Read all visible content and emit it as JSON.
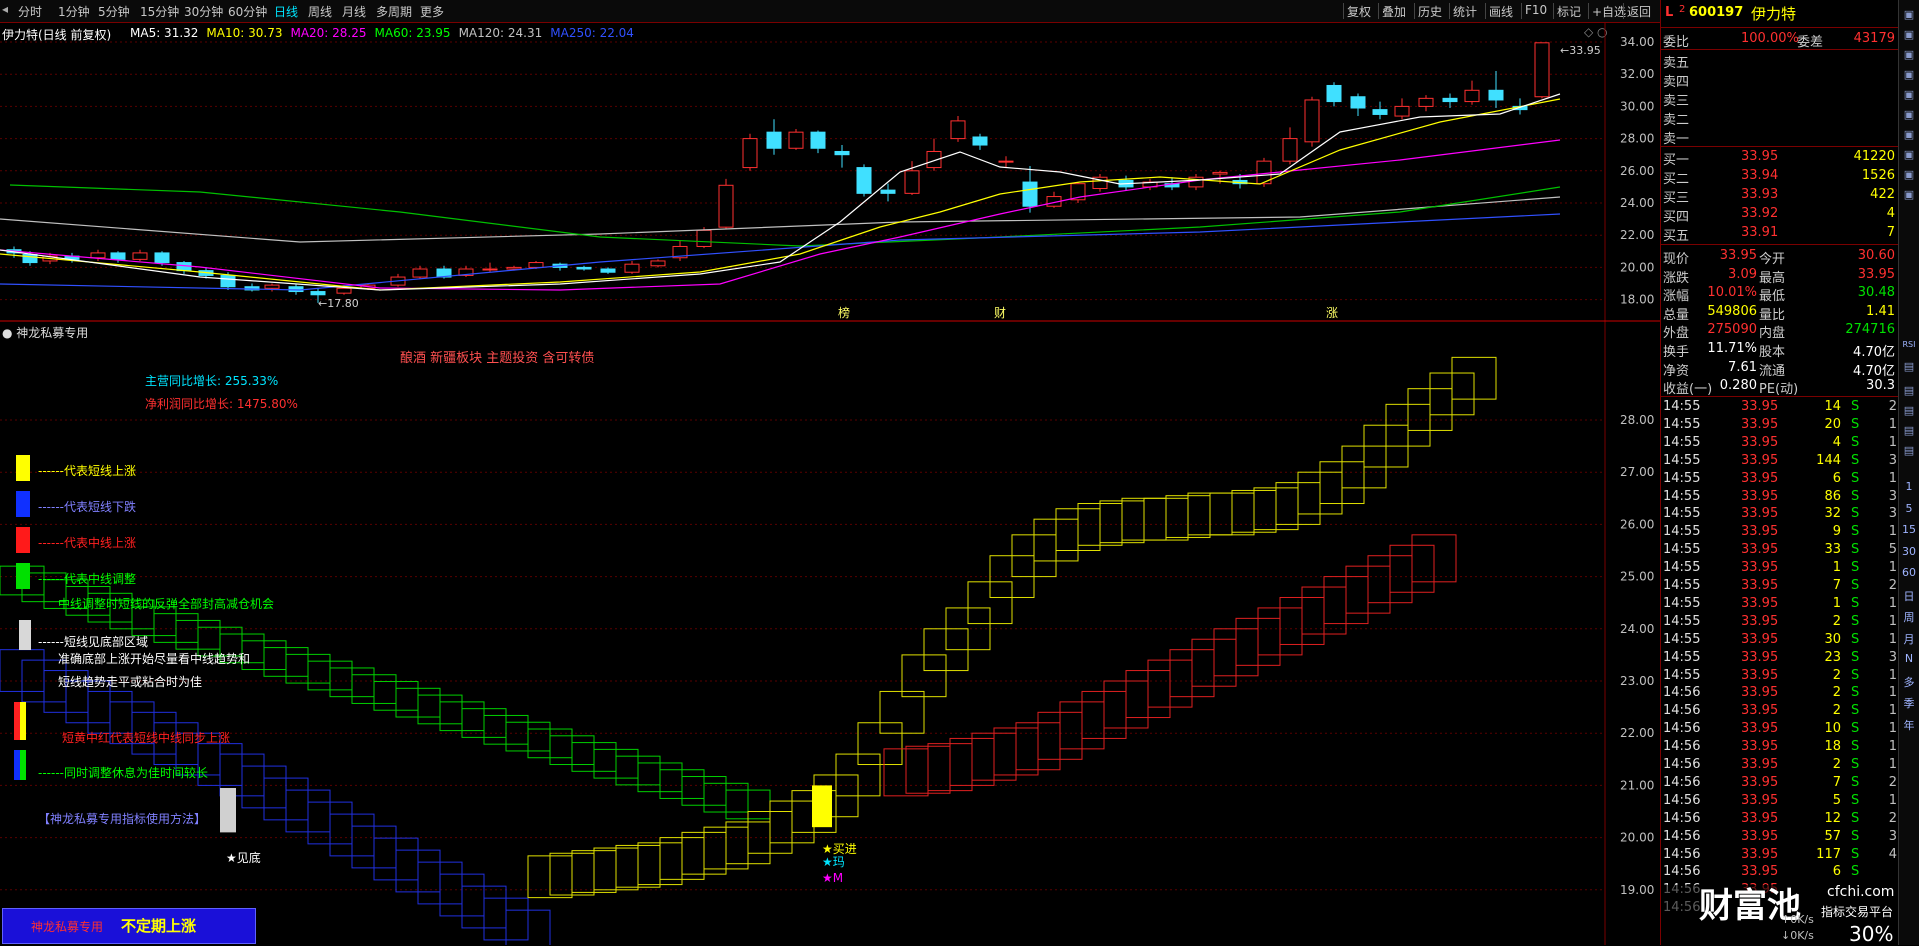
{
  "toolbar": {
    "periods": [
      "分时",
      "1分钟",
      "5分钟",
      "15分钟",
      "30分钟",
      "60分钟",
      "日线",
      "周线",
      "月线",
      "多周期",
      "更多"
    ],
    "active_period": "日线",
    "actions": [
      "复权",
      "叠加",
      "历史",
      "统计",
      "画线",
      "F10",
      "标记",
      "+自选",
      "返回"
    ]
  },
  "price_chart": {
    "title": "伊力特(日线 前复权)",
    "ma": [
      {
        "label": "MA5: 31.32",
        "color": "#ffffff"
      },
      {
        "label": "MA10: 30.73",
        "color": "#ffff00"
      },
      {
        "label": "MA20: 28.25",
        "color": "#ff00ff"
      },
      {
        "label": "MA60: 23.95",
        "color": "#00ff00"
      },
      {
        "label": "MA120: 24.31",
        "color": "#c0c0c0"
      },
      {
        "label": "MA250: 22.04",
        "color": "#3050ff"
      }
    ],
    "y_ticks": [
      "34.00",
      "32.00",
      "30.00",
      "28.00",
      "26.00",
      "24.00",
      "22.00",
      "20.00",
      "18.00"
    ],
    "high_label": "33.95",
    "low_label": "17.80",
    "markers": [
      "榜",
      "财",
      "涨"
    ]
  },
  "indicator": {
    "title": "神龙私募专用",
    "tags": "酿酒 新疆板块 主题投资 含可转债",
    "revenue_growth": "主营同比增长: 255.33%",
    "profit_growth": "净利润同比增长: 1475.80%",
    "y_ticks": [
      "28.00",
      "27.00",
      "26.00",
      "25.00",
      "24.00",
      "23.00",
      "22.00",
      "21.00",
      "20.00",
      "19.00"
    ],
    "legend": [
      {
        "text": "------代表短线上涨",
        "color": "#ffff00"
      },
      {
        "text": "------代表短线下跌",
        "color": "#8080ff"
      },
      {
        "text": "------代表中线上涨",
        "color": "#ff2020"
      },
      {
        "text": "------代表中线调整",
        "color": "#00ff00"
      },
      {
        "text": "中线调整时短线的反弹全部封高减仓机会",
        "color": "#00ff00"
      },
      {
        "text": "------短线见底部区域",
        "color": "#ffffff"
      },
      {
        "text": "准确底部上涨开始尽量看中线趋势和",
        "color": "#ffffff"
      },
      {
        "text": "短线趋势走平或粘合时为佳",
        "color": "#ffffff"
      },
      {
        "text": "短黄中红代表短线中线同步上涨",
        "color": "#ff2020"
      },
      {
        "text": "------同时调整休息为佳时间较长",
        "color": "#00ff00"
      }
    ],
    "usage_label": "【神龙私募专用指标使用方法】",
    "bottom_label": "神龙私募专用",
    "bottom_highlight": "不定期上涨",
    "signals": {
      "bottom": "★见底",
      "buy": "★买进",
      "j": "★玛",
      "m": "★M"
    }
  },
  "quote": {
    "code": "600197",
    "name": "伊力特",
    "weibi_label": "委比",
    "weibi": "100.00%",
    "weicha_label": "委差",
    "weicha": "43179",
    "sell": [
      "卖五",
      "卖四",
      "卖三",
      "卖二",
      "卖一"
    ],
    "buy": [
      {
        "label": "买一",
        "price": "33.95",
        "vol": "41220"
      },
      {
        "label": "买二",
        "price": "33.94",
        "vol": "1526"
      },
      {
        "label": "买三",
        "price": "33.93",
        "vol": "422"
      },
      {
        "label": "买四",
        "price": "33.92",
        "vol": "4"
      },
      {
        "label": "买五",
        "price": "33.91",
        "vol": "7"
      }
    ],
    "stats": [
      {
        "l1": "现价",
        "v1": "33.95",
        "c1": "#ff3030",
        "l2": "今开",
        "v2": "30.60",
        "c2": "#ff3030"
      },
      {
        "l1": "涨跌",
        "v1": "3.09",
        "c1": "#ff3030",
        "l2": "最高",
        "v2": "33.95",
        "c2": "#ff3030"
      },
      {
        "l1": "涨幅",
        "v1": "10.01%",
        "c1": "#ff3030",
        "l2": "最低",
        "v2": "30.48",
        "c2": "#00e000"
      },
      {
        "l1": "总量",
        "v1": "549806",
        "c1": "#ffff00",
        "l2": "量比",
        "v2": "1.41",
        "c2": "#ffff00"
      },
      {
        "l1": "外盘",
        "v1": "275090",
        "c1": "#ff3030",
        "l2": "内盘",
        "v2": "274716",
        "c2": "#00e000"
      },
      {
        "l1": "换手",
        "v1": "11.71%",
        "c1": "#ffffff",
        "l2": "股本",
        "v2": "4.70亿",
        "c2": "#ffffff"
      },
      {
        "l1": "净资",
        "v1": "7.61",
        "c1": "#ffffff",
        "l2": "流通",
        "v2": "4.70亿",
        "c2": "#ffffff"
      },
      {
        "l1": "收益(一)",
        "v1": "0.280",
        "c1": "#ffffff",
        "l2": "PE(动)",
        "v2": "30.3",
        "c2": "#ffffff"
      }
    ],
    "ticks": [
      {
        "t": "14:55",
        "p": "33.95",
        "v": "14",
        "n": "2"
      },
      {
        "t": "14:55",
        "p": "33.95",
        "v": "20",
        "n": "1"
      },
      {
        "t": "14:55",
        "p": "33.95",
        "v": "4",
        "n": "1"
      },
      {
        "t": "14:55",
        "p": "33.95",
        "v": "144",
        "n": "3"
      },
      {
        "t": "14:55",
        "p": "33.95",
        "v": "6",
        "n": "1"
      },
      {
        "t": "14:55",
        "p": "33.95",
        "v": "86",
        "n": "3"
      },
      {
        "t": "14:55",
        "p": "33.95",
        "v": "32",
        "n": "3"
      },
      {
        "t": "14:55",
        "p": "33.95",
        "v": "9",
        "n": "1"
      },
      {
        "t": "14:55",
        "p": "33.95",
        "v": "33",
        "n": "5"
      },
      {
        "t": "14:55",
        "p": "33.95",
        "v": "1",
        "n": "1"
      },
      {
        "t": "14:55",
        "p": "33.95",
        "v": "7",
        "n": "2"
      },
      {
        "t": "14:55",
        "p": "33.95",
        "v": "1",
        "n": "1"
      },
      {
        "t": "14:55",
        "p": "33.95",
        "v": "2",
        "n": "1"
      },
      {
        "t": "14:55",
        "p": "33.95",
        "v": "30",
        "n": "1"
      },
      {
        "t": "14:55",
        "p": "33.95",
        "v": "23",
        "n": "3"
      },
      {
        "t": "14:55",
        "p": "33.95",
        "v": "2",
        "n": "1"
      },
      {
        "t": "14:56",
        "p": "33.95",
        "v": "2",
        "n": "1"
      },
      {
        "t": "14:56",
        "p": "33.95",
        "v": "2",
        "n": "1"
      },
      {
        "t": "14:56",
        "p": "33.95",
        "v": "10",
        "n": "1"
      },
      {
        "t": "14:56",
        "p": "33.95",
        "v": "18",
        "n": "1"
      },
      {
        "t": "14:56",
        "p": "33.95",
        "v": "2",
        "n": "1"
      },
      {
        "t": "14:56",
        "p": "33.95",
        "v": "7",
        "n": "2"
      },
      {
        "t": "14:56",
        "p": "33.95",
        "v": "5",
        "n": "1"
      },
      {
        "t": "14:56",
        "p": "33.95",
        "v": "12",
        "n": "2"
      },
      {
        "t": "14:56",
        "p": "33.95",
        "v": "57",
        "n": "3"
      },
      {
        "t": "14:56",
        "p": "33.95",
        "v": "117",
        "n": "4"
      },
      {
        "t": "14:56",
        "p": "33.95",
        "v": "6",
        "n": ""
      },
      {
        "t": "14:56",
        "p": "33.95",
        "v": "",
        "n": ""
      },
      {
        "t": "14:56",
        "p": "",
        "v": "",
        "n": ""
      }
    ],
    "side_flag": "S",
    "status_speed1": "0K/s",
    "status_speed2": "0K/s",
    "status_pct": "30%"
  },
  "side_bar": [
    "1",
    "5",
    "15",
    "30",
    "60",
    "日",
    "周",
    "月",
    "N",
    "多",
    "季",
    "年",
    "RSI"
  ],
  "watermark": {
    "brand": "财富池",
    "url": "cfchi.com",
    "slogan": "指标交易平台"
  }
}
